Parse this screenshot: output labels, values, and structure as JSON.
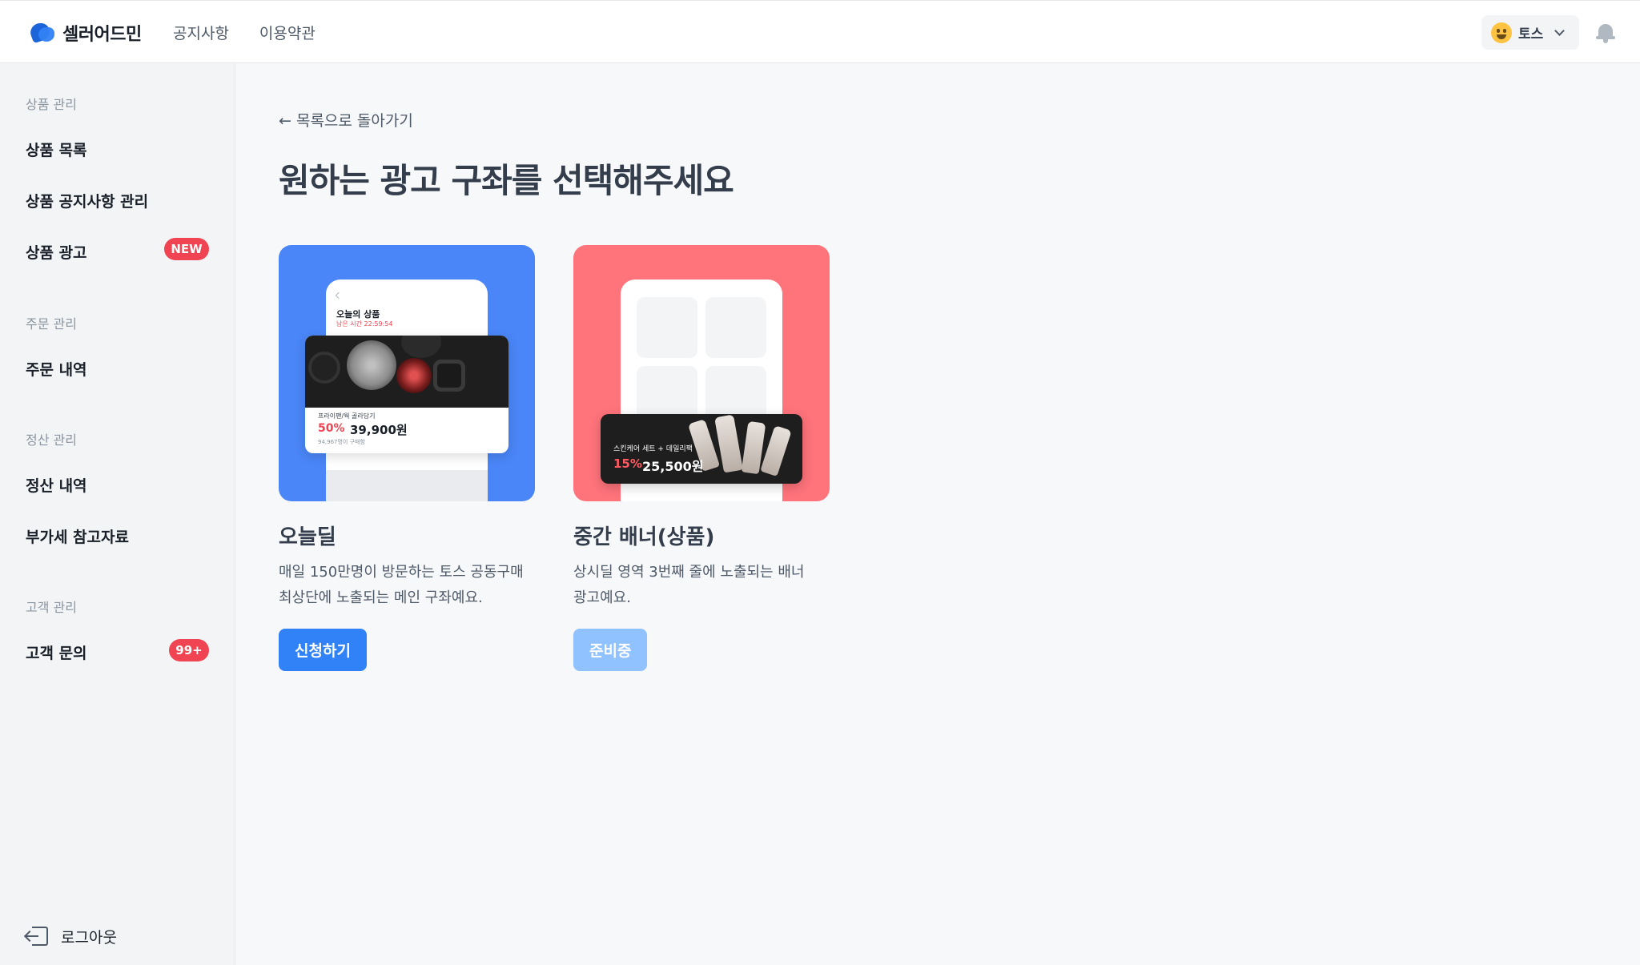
{
  "header": {
    "logo_text": "셀러어드민",
    "nav": [
      "공지사항",
      "이용약관"
    ],
    "account_name": "토스",
    "icons": {
      "logo": "seller-admin-logo-icon",
      "account": "smiley-emoji-icon",
      "dropdown": "chevron-down-icon",
      "notifications": "bell-icon"
    }
  },
  "sidebar": {
    "sections": [
      {
        "title": "상품 관리",
        "items": [
          {
            "label": "상품 목록"
          },
          {
            "label": "상품 공지사항 관리"
          },
          {
            "label": "상품 광고",
            "badge": "NEW"
          }
        ]
      },
      {
        "title": "주문 관리",
        "items": [
          {
            "label": "주문 내역"
          }
        ]
      },
      {
        "title": "정산 관리",
        "items": [
          {
            "label": "정산 내역"
          },
          {
            "label": "부가세 참고자료"
          }
        ]
      },
      {
        "title": "고객 관리",
        "items": [
          {
            "label": "고객 문의",
            "badge": "99+"
          }
        ]
      }
    ],
    "logout_label": "로그아웃"
  },
  "main": {
    "back_link": "← 목록으로 돌아가기",
    "title": "원하는 광고 구좌를 선택해주세요",
    "cards": [
      {
        "name": "오늘딜",
        "description": "매일 150만명이 방문하는 토스 공동구매\n최상단에 노출되는 메인 구좌예요.",
        "button_label": "신청하기",
        "button_enabled": true,
        "color": "#4a86f7",
        "preview": {
          "section_title": "오늘의 상품",
          "timer": "남은 시간 22:59:54",
          "product_name": "프라이팬/웍 골라담기",
          "discount": "50%",
          "price": "39,900원",
          "buyers": "94,967명이 구매함"
        }
      },
      {
        "name": "중간 배너(상품)",
        "description": "상시딜 영역 3번째 줄에 노출되는 배너\n광고예요.",
        "button_label": "준비중",
        "button_enabled": false,
        "color": "#ff737b",
        "preview": {
          "product_name": "스킨케어 세트 + 데일리팩",
          "discount": "15%",
          "price": "25,500원"
        }
      }
    ]
  },
  "colors": {
    "primary": "#3182f6",
    "primary_disabled": "#90c2ff",
    "badge": "#f04452"
  }
}
